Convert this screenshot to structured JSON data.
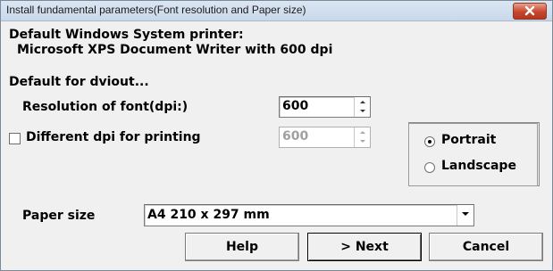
{
  "window": {
    "title": "Install fundamental parameters(Font resolution and Paper size)"
  },
  "system_printer": {
    "heading": "Default Windows System printer:",
    "name": "Microsoft XPS Document Writer with 600 dpi"
  },
  "defaults": {
    "heading": "Default for dviout...",
    "resolution_label": "Resolution of font(dpi:)",
    "resolution_value": "600",
    "different_dpi_label": "Different dpi for printing",
    "different_dpi_checked": false,
    "printing_dpi_value": "600"
  },
  "orientation": {
    "portrait_label": "Portrait",
    "landscape_label": "Landscape",
    "selected": "Portrait"
  },
  "paper": {
    "label": "Paper size",
    "value": "A4  210 x 297 mm"
  },
  "buttons": {
    "help": "Help",
    "next": "> Next",
    "cancel": "Cancel"
  },
  "colors": {
    "close_button": "#c8452c",
    "dialog_background": "#f0f0f0"
  }
}
